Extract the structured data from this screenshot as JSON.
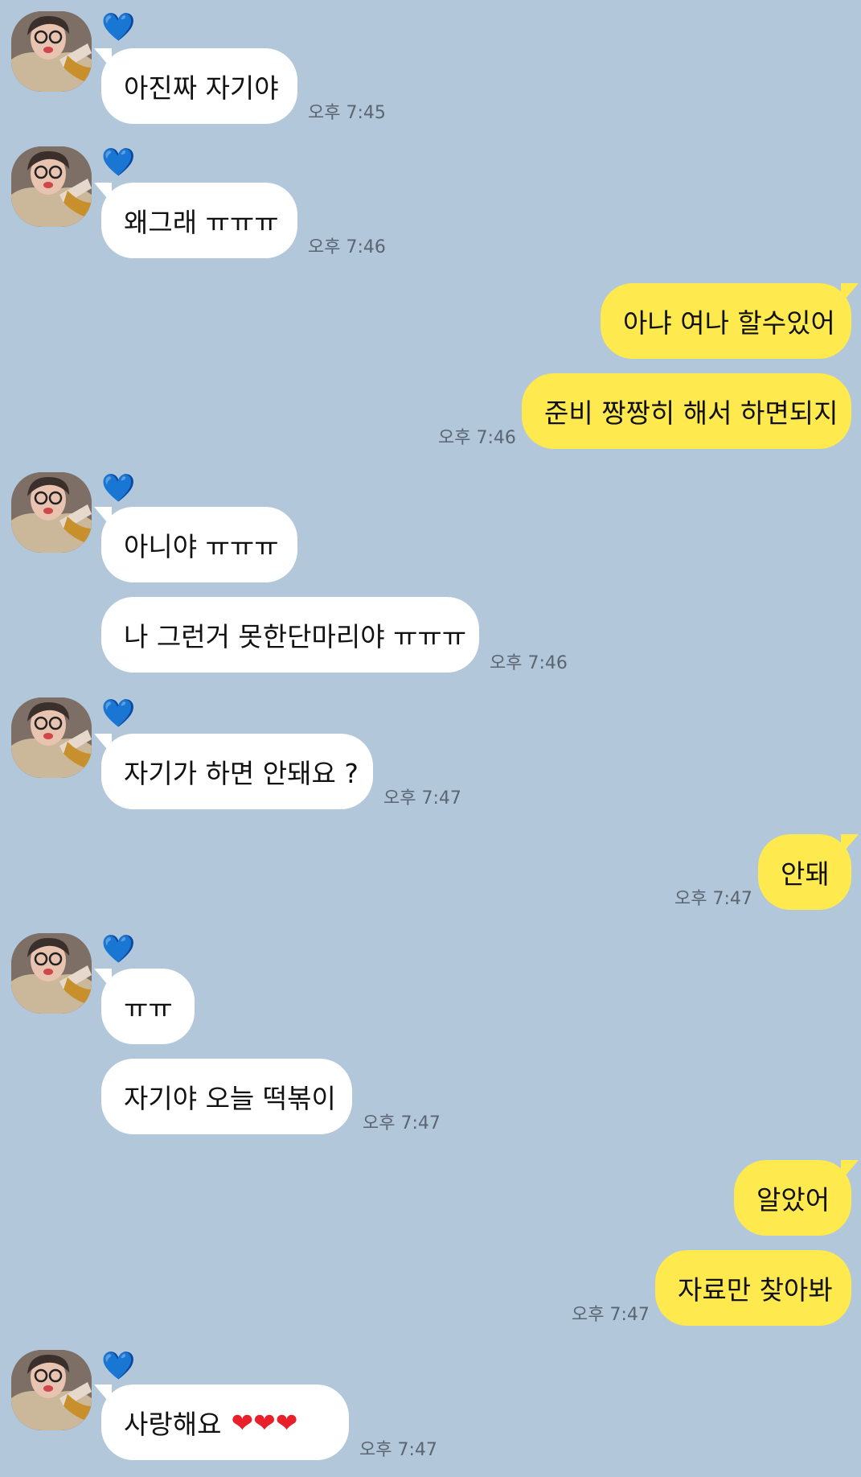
{
  "chat": {
    "sender_name": "💙",
    "messages": [
      {
        "text": "아진짜 자기야",
        "time": "오후 7:45"
      },
      {
        "text": "왜그래 ㅠㅠㅠ",
        "time": "오후 7:46"
      },
      {
        "text": "아냐 여나 할수있어"
      },
      {
        "text": "준비 짱짱히 해서 하면되지",
        "time": "오후 7:46"
      },
      {
        "text": "아니야 ㅠㅠㅠ"
      },
      {
        "text": "나 그런거 못한단마리야 ㅠㅠㅠ",
        "time": "오후 7:46"
      },
      {
        "text": "자기가 하면 안돼요 ?",
        "time": "오후 7:47"
      },
      {
        "text": "안돼",
        "time": "오후 7:47"
      },
      {
        "text": "ㅠㅠ"
      },
      {
        "text": "자기야 오늘 떡볶이",
        "time": "오후 7:47"
      },
      {
        "text": "알았어"
      },
      {
        "text": "자료만 찾아봐",
        "time": "오후 7:47"
      },
      {
        "text": "사랑해요",
        "emoji": "❤❤❤",
        "time": "오후 7:47"
      }
    ]
  },
  "colors": {
    "background": "#b2c7da",
    "incoming_bubble": "#ffffff",
    "outgoing_bubble": "#fee94e",
    "timestamp": "#5b6672"
  }
}
